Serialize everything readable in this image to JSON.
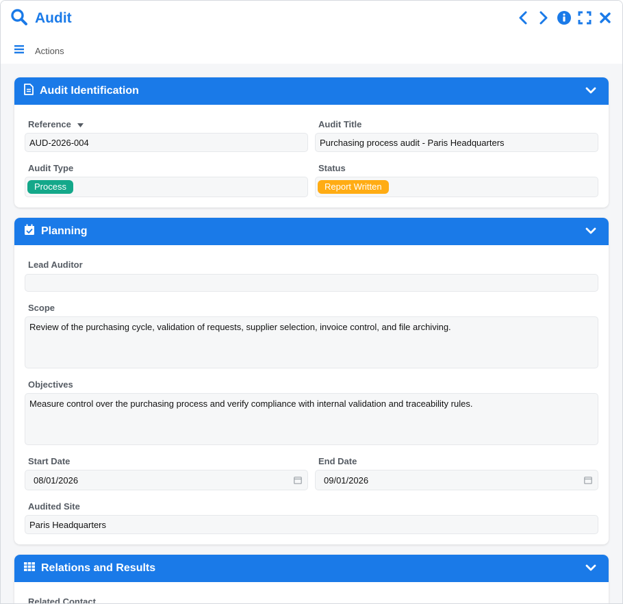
{
  "window": {
    "title": "Audit",
    "controls": [
      "chevron-left-icon",
      "chevron-right-icon",
      "info-icon",
      "fullscreen-icon",
      "close-icon"
    ]
  },
  "toolbar": {
    "actions_label": "Actions"
  },
  "colors": {
    "accent": "#1a7ae8",
    "process_badge": "#14a88a",
    "status_badge": "#ffac14"
  },
  "sections": {
    "identification": {
      "title": "Audit Identification",
      "reference": {
        "label": "Reference",
        "value": "AUD-2026-004"
      },
      "audit_title": {
        "label": "Audit Title",
        "value": "Purchasing process audit - Paris Headquarters"
      },
      "audit_type": {
        "label": "Audit Type",
        "value": "Process"
      },
      "status": {
        "label": "Status",
        "value": "Report Written"
      }
    },
    "planning": {
      "title": "Planning",
      "lead_auditor": {
        "label": "Lead Auditor",
        "value": ""
      },
      "scope": {
        "label": "Scope",
        "value": "Review of the purchasing cycle, validation of requests, supplier selection, invoice control, and file archiving."
      },
      "objectives": {
        "label": "Objectives",
        "value": "Measure control over the purchasing process and verify compliance with internal validation and traceability rules."
      },
      "start_date": {
        "label": "Start Date",
        "value": "08/01/2026"
      },
      "end_date": {
        "label": "End Date",
        "value": "09/01/2026"
      },
      "audited_site": {
        "label": "Audited Site",
        "value": "Paris Headquarters"
      }
    },
    "relations": {
      "title": "Relations and Results",
      "related_contact": {
        "label": "Related Contact"
      }
    }
  }
}
